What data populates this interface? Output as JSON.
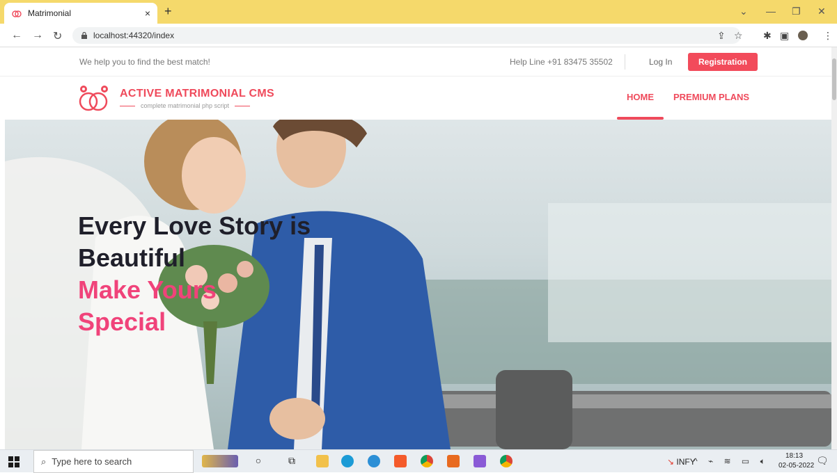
{
  "browser": {
    "tab_title": "Matrimonial",
    "url": "localhost:44320/index",
    "new_tab": "+",
    "close_tab": "×"
  },
  "topbar": {
    "tagline": "We help you to find the best match!",
    "helpline": "Help Line +91 83475 35502",
    "login": "Log In",
    "registration": "Registration"
  },
  "header": {
    "logo_title": "ACTIVE MATRIMONIAL CMS",
    "logo_subtitle": "complete matrimonial php script",
    "nav": [
      {
        "label": "HOME"
      },
      {
        "label": "PREMIUM PLANS"
      }
    ]
  },
  "hero": {
    "line1": "Every Love Story is",
    "line2": "Beautiful",
    "line3": "Make Yours",
    "line4": "Special"
  },
  "taskbar": {
    "search_placeholder": "Type here to search",
    "stock": "INFY",
    "time": "18:13",
    "date": "02-05-2022"
  },
  "colors": {
    "brand_pink": "#ef4a5b",
    "hero_pink": "#f0437a",
    "tab_bar": "#f5d96b"
  }
}
